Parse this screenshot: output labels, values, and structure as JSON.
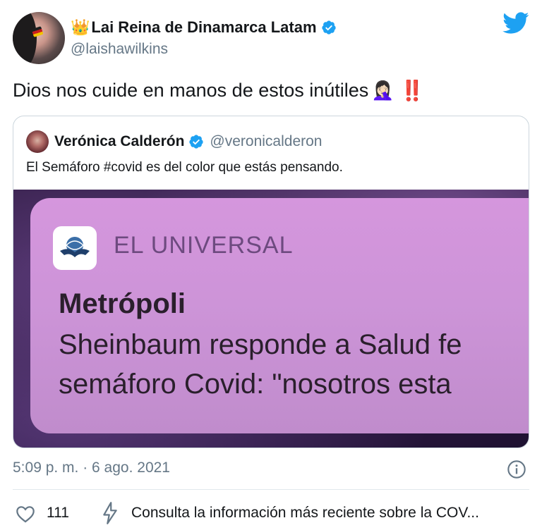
{
  "author": {
    "crown_emoji": "👑",
    "display_name": "Lai Reina de Dinamarca Latam",
    "handle": "@laishawilkins",
    "verified": true
  },
  "tweet": {
    "text": "Dios nos cuide en manos de estos inútiles",
    "emoji_1": "🤦🏻‍♀️",
    "emoji_2": "‼️"
  },
  "quoted": {
    "display_name": "Verónica Calderón",
    "handle": "@veronicalderon",
    "verified": true,
    "text": "El Semáforo #covid es del color que estás pensando.",
    "media": {
      "source": "EL UNIVERSAL",
      "title": "Metrópoli",
      "body_line1": "Sheinbaum responde a Salud fe",
      "body_line2": "semáforo Covid: \"nosotros esta"
    }
  },
  "meta": {
    "timestamp": "5:09 p. m. · 6 ago. 2021"
  },
  "actions": {
    "like_count": "111",
    "consulta": "Consulta la información más reciente sobre la COV..."
  },
  "colors": {
    "twitter_blue": "#1da1f2",
    "like_red": "#e0245e",
    "muted": "#657786"
  },
  "icons": [
    "twitter-logo-icon",
    "verified-badge-icon",
    "info-icon",
    "heart-icon",
    "lightning-icon"
  ]
}
